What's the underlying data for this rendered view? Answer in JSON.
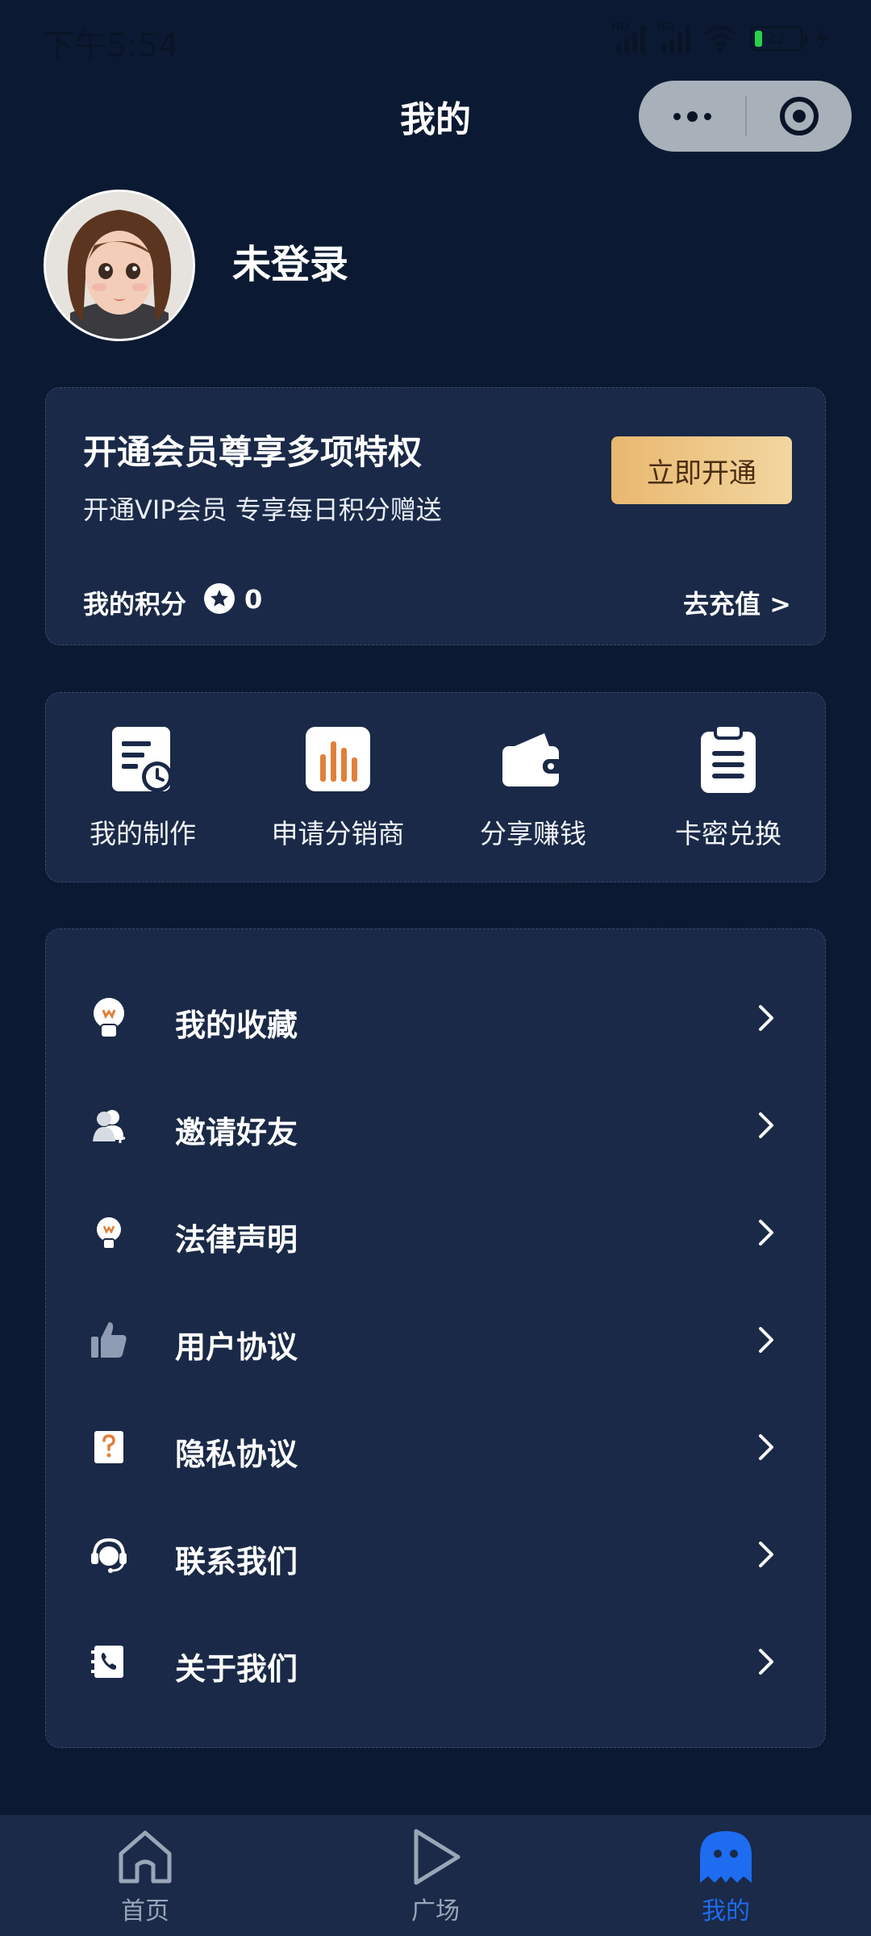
{
  "status_bar": {
    "time": "下午5:54",
    "signal_tag": "HD",
    "battery_level": "22"
  },
  "header": {
    "title": "我的"
  },
  "profile": {
    "username": "未登录"
  },
  "vip": {
    "title": "开通会员尊享多项特权",
    "subtitle": "开通VIP会员 专享每日积分赠送",
    "button": "立即开通",
    "points_label": "我的积分",
    "points_value": "0",
    "recharge": "去充值 >"
  },
  "quick_actions": [
    {
      "label": "我的制作",
      "icon": "document-clock-icon"
    },
    {
      "label": "申请分销商",
      "icon": "bar-chart-icon"
    },
    {
      "label": "分享赚钱",
      "icon": "wallet-icon"
    },
    {
      "label": "卡密兑换",
      "icon": "clipboard-icon"
    }
  ],
  "menu": [
    {
      "label": "我的收藏",
      "icon": "lightbulb-icon"
    },
    {
      "label": "邀请好友",
      "icon": "add-user-icon"
    },
    {
      "label": "法律声明",
      "icon": "lightbulb-small-icon"
    },
    {
      "label": "用户协议",
      "icon": "thumbs-up-icon"
    },
    {
      "label": "隐私协议",
      "icon": "question-icon"
    },
    {
      "label": "联系我们",
      "icon": "headset-icon"
    },
    {
      "label": "关于我们",
      "icon": "phone-book-icon"
    }
  ],
  "tabs": [
    {
      "label": "首页",
      "icon": "home-icon"
    },
    {
      "label": "广场",
      "icon": "play-icon"
    },
    {
      "label": "我的",
      "icon": "ghost-icon",
      "active": true
    }
  ],
  "colors": {
    "background": "#0b1a32",
    "card": "#1a2947",
    "accent_gold": "#e9b86f",
    "icon_orange": "#e0803a",
    "tab_active": "#1e6cf0",
    "tab_inactive": "#9aa6b8"
  }
}
